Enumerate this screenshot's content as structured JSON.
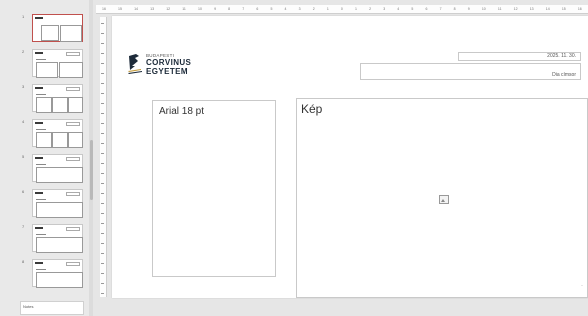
{
  "thumbnails": [
    {
      "num": "1",
      "selected": true
    },
    {
      "num": "2"
    },
    {
      "num": "3"
    },
    {
      "num": "4"
    },
    {
      "num": "5"
    },
    {
      "num": "6"
    },
    {
      "num": "7"
    },
    {
      "num": "8"
    }
  ],
  "notes_label": "Notes",
  "ruler_ticks": [
    "16",
    "15",
    "14",
    "13",
    "12",
    "11",
    "10",
    "9",
    "8",
    "7",
    "6",
    "5",
    "4",
    "3",
    "2",
    "1",
    "0",
    "1",
    "2",
    "3",
    "4",
    "5",
    "6",
    "7",
    "8",
    "9",
    "10",
    "11",
    "12",
    "13",
    "14",
    "15",
    "16"
  ],
  "slide": {
    "logo_small": "BUDAPESTI",
    "logo_line1": "CORVINUS",
    "logo_line2": "EGYETEM",
    "date": "2025. 11. 30.",
    "title_placeholder": "Dia címsor",
    "left_text": "Arial 18 pt",
    "image_label": "Kép"
  },
  "colors": {
    "selected_border": "#c0504d",
    "logo_text": "#1d2b3a"
  }
}
